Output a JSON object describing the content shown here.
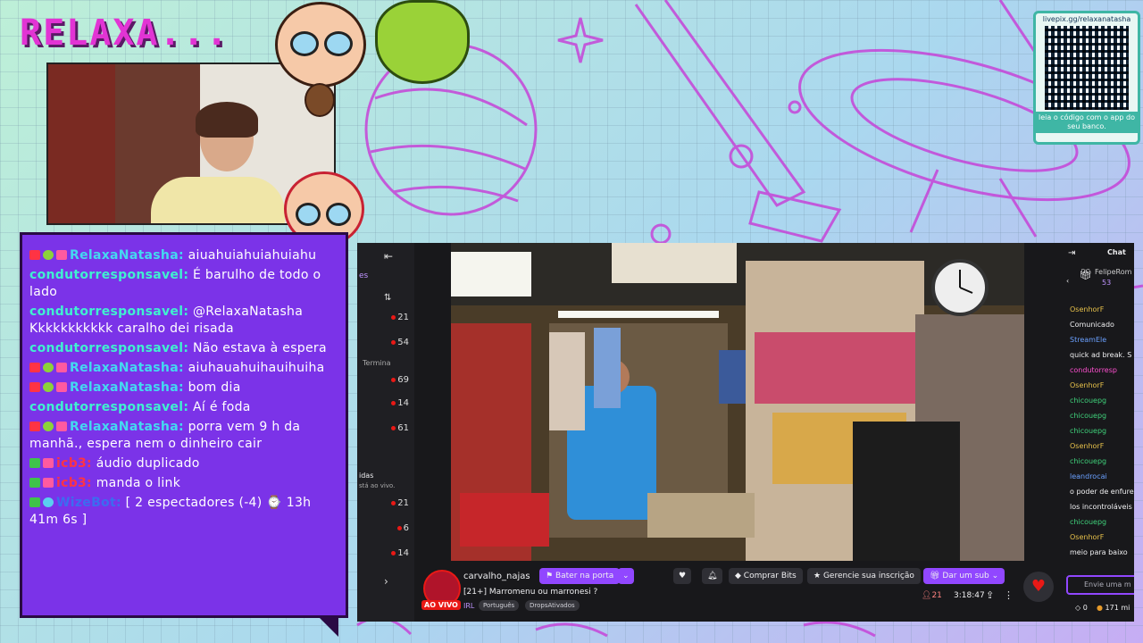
{
  "overlay": {
    "title": "RELAXA...",
    "qr": {
      "link": "livepix.gg/relaxanatasha",
      "caption": "leia o código com o app do seu banco."
    }
  },
  "chat_overlay": {
    "messages": [
      {
        "user": "RelaxaNatasha:",
        "text": "aiuahuiahuiahuiahu",
        "style": "relaxa"
      },
      {
        "user": "condutorresponsavel:",
        "text": "É barulho de todo o lado",
        "style": "cond"
      },
      {
        "user": "condutorresponsavel:",
        "text": "@RelaxaNatasha Kkkkkkkkkkk caralho dei risada",
        "style": "cond"
      },
      {
        "user": "condutorresponsavel:",
        "text": "Não estava à espera",
        "style": "cond"
      },
      {
        "user": "RelaxaNatasha:",
        "text": "aiuhauahuihauihuiha",
        "style": "relaxa"
      },
      {
        "user": "RelaxaNatasha:",
        "text": "bom dia",
        "style": "relaxa"
      },
      {
        "user": "condutorresponsavel:",
        "text": "Aí é foda",
        "style": "cond"
      },
      {
        "user": "RelaxaNatasha:",
        "text": "porra vem 9 h da manhã., espera nem o dinheiro cair",
        "style": "relaxa"
      },
      {
        "user": "icb3:",
        "text": "áudio duplicado",
        "style": "icb"
      },
      {
        "user": "icb3:",
        "text": "manda o link",
        "style": "icb"
      },
      {
        "user": "WizeBot:",
        "text": "[ 2 espectadores (-4) ⌚ 13h 41m 6s ]",
        "style": "wiz"
      }
    ]
  },
  "twitch": {
    "sidebar": {
      "section1": "es",
      "counts": [
        "21",
        "54",
        "69",
        "14",
        "61"
      ],
      "item_label": "Termina",
      "section2": "idas",
      "section2_sub": "stá ao vivo.",
      "counts2": [
        "21",
        "6",
        "14"
      ]
    },
    "channel": "carvalho_najas",
    "live_label": "AO VIVO",
    "stream_title": "[21+] Marromenu ou marronesi ?",
    "category": "IRL",
    "tags": [
      "Português",
      "DropsAtivados"
    ],
    "buttons": {
      "knock": "Bater na porta",
      "bits": "Comprar Bits",
      "sub_manage": "Gerencie sua inscrição",
      "gift_sub": "Dar um sub"
    },
    "viewers": "21",
    "uptime": "3:18:47",
    "chat": {
      "header": "Chat",
      "pinned_user": "FelipeRom",
      "pinned_count": "53",
      "lines": [
        "OsenhorF",
        "Comunicado",
        "StreamEle",
        "quick ad break. S",
        "condutorresp",
        "OsenhorF",
        "chicouepg",
        "chicouepg",
        "chicouepg",
        "OsenhorF",
        "chicouepg",
        "leandrocai",
        "o poder de enfurec",
        "los incontroláveis",
        "chicouepg",
        "OsenhorF",
        "meio para baixo"
      ],
      "input_placeholder": "Envie uma m",
      "points": "171 mi",
      "bits_count": "0"
    }
  },
  "colors": {
    "accent": "#9147ff",
    "live_red": "#e91916",
    "overlay_purple": "#7b33e8",
    "title_pink": "#e234d4"
  }
}
